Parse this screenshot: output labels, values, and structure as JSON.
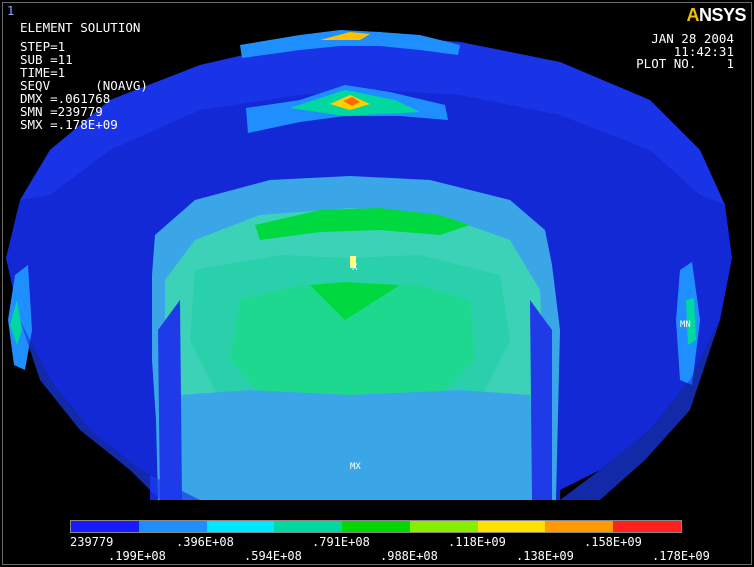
{
  "window_number": "1",
  "logo": {
    "text_a": "A",
    "text_rest": "NSYS"
  },
  "header": {
    "title": "ELEMENT SOLUTION",
    "step": "STEP=1",
    "sub": "SUB =11",
    "time": "TIME=1",
    "seqv": "SEQV      (NOAVG)",
    "dmx": "DMX =.061768",
    "smn": "SMN =239779",
    "smx": "SMX =.178E+09"
  },
  "right_info": {
    "date": "JAN 28 2004",
    "time": "11:42:31",
    "plot_no": "PLOT NO.    1"
  },
  "markers": {
    "x": "X",
    "mn": "MN",
    "mx": "MX"
  },
  "legend": {
    "colors": [
      "#1a1aff",
      "#1f8fff",
      "#00e8ff",
      "#00d8a0",
      "#00d800",
      "#88ee00",
      "#ffe000",
      "#ff9900",
      "#ff2020"
    ],
    "labels_top": [
      "239779",
      ".396E+08",
      ".791E+08",
      ".118E+09",
      ".158E+09"
    ],
    "labels_bottom": [
      ".199E+08",
      ".594E+08",
      ".988E+08",
      ".138E+09",
      ".178E+09"
    ]
  }
}
